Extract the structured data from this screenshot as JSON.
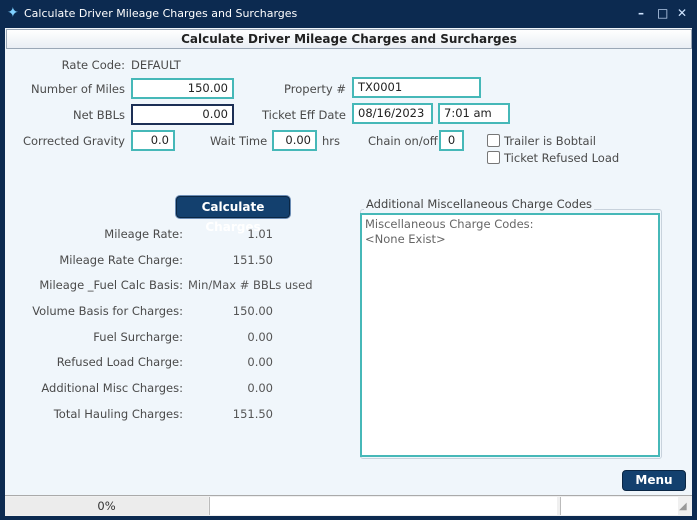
{
  "window": {
    "title": "Calculate Driver Mileage Charges and Surcharges",
    "icon": "app-logo-icon",
    "controls": [
      "minimize",
      "maximize",
      "close"
    ]
  },
  "header": {
    "title": "Calculate Driver Mileage Charges and Surcharges"
  },
  "form": {
    "rate_code_label": "Rate Code:",
    "rate_code_value": "DEFAULT",
    "miles_label": "Number of Miles",
    "miles_value": "150.00",
    "net_bbls_label": "Net BBLs",
    "net_bbls_value": "0.00",
    "gravity_label": "Corrected Gravity",
    "gravity_value": "0.0",
    "wait_label": "Wait Time",
    "wait_value": "0.00",
    "wait_unit": "hrs",
    "property_label": "Property #",
    "property_value": "TX0001",
    "ticket_date_label": "Ticket Eff Date",
    "ticket_date_value": "08/16/2023",
    "ticket_time_value": "7:01 am",
    "chain_label": "Chain on/off",
    "chain_value": "0",
    "bobtail_label": "Trailer is Bobtail",
    "bobtail_checked": false,
    "refused_label": "Ticket Refused Load",
    "refused_checked": false
  },
  "calculate_button": "Calculate Charges",
  "results": [
    {
      "label": "Mileage Rate:",
      "value": "1.01"
    },
    {
      "label": "Mileage Rate Charge:",
      "value": "151.50"
    },
    {
      "label": "Mileage _Fuel Calc Basis:",
      "value": "Min/Max # BBLs used"
    },
    {
      "label": "Volume Basis for Charges:",
      "value": "150.00"
    },
    {
      "label": "Fuel Surcharge:",
      "value": "0.00"
    },
    {
      "label": "Refused Load Charge:",
      "value": "0.00"
    },
    {
      "label": "Additional Misc Charges:",
      "value": "0.00"
    },
    {
      "label": "Total Hauling Charges:",
      "value": "151.50"
    }
  ],
  "misc": {
    "group_label": "Additional Miscellaneous Charge Codes",
    "line1": "Miscellaneous Charge Codes:",
    "line2": "<None Exist>"
  },
  "menu_button": "Menu",
  "status": {
    "progress": "0%"
  },
  "colors": {
    "frame": "#0c2a50",
    "button": "#13406e",
    "input_border": "#46b8b8"
  }
}
